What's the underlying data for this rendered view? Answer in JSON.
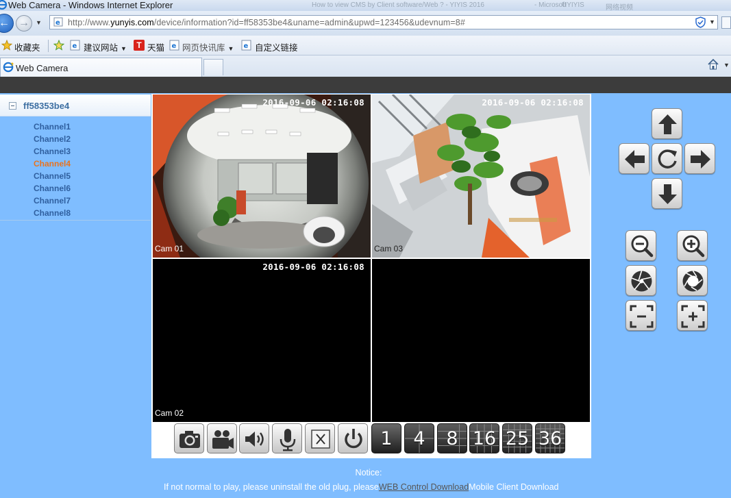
{
  "window": {
    "title": "Web Camera - Windows Internet Explorer",
    "background_title_fragment": "How to view CMS by Client software/Web ? - YIYIS 2016",
    "background_ctl": "- Microsoft",
    "background_ctl2": "UYIYIS",
    "background_tail": "网络视频"
  },
  "address_bar": {
    "url_prefix": "http://www.",
    "url_domain": "yunyis.com",
    "url_rest": "/device/information?id=ff58353be4&uname=admin&upwd=123456&udevnum=8#"
  },
  "favorites_bar": {
    "favorites_label": "收藏夹",
    "items": [
      {
        "label": "建议网站",
        "dropdown": true
      },
      {
        "label": "天猫",
        "dropdown": false
      },
      {
        "label": "网页快讯库",
        "dropdown": true
      },
      {
        "label": "自定义链接",
        "dropdown": false
      }
    ]
  },
  "tabs": [
    {
      "label": "Web Camera",
      "active": true
    }
  ],
  "sidebar": {
    "device_name": "ff58353be4",
    "channels": [
      {
        "label": "Channel1",
        "active": false
      },
      {
        "label": "Channel2",
        "active": false
      },
      {
        "label": "Channel3",
        "active": false
      },
      {
        "label": "Channel4",
        "active": true
      },
      {
        "label": "Channel5",
        "active": false
      },
      {
        "label": "Channel6",
        "active": false
      },
      {
        "label": "Channel7",
        "active": false
      },
      {
        "label": "Channel8",
        "active": false
      }
    ]
  },
  "video": {
    "cells": [
      {
        "timestamp": "2016-09-06 02:16:08",
        "cam_label": "Cam 01",
        "has_feed": true,
        "selected": false
      },
      {
        "timestamp": "2016-09-06 02:16:08",
        "cam_label": "Cam 03",
        "has_feed": true,
        "selected": true
      },
      {
        "timestamp": "2016-09-06 02:16:08",
        "cam_label": "Cam 02",
        "has_feed": false,
        "selected": false
      },
      {
        "timestamp": "",
        "cam_label": "",
        "has_feed": false,
        "selected": false
      }
    ]
  },
  "toolbar": {
    "action_buttons": [
      "snapshot-icon",
      "record-icon",
      "audio-icon",
      "microphone-icon",
      "close-all-icon",
      "power-icon"
    ],
    "layout_buttons": [
      "1",
      "4",
      "8",
      "16",
      "25",
      "36"
    ]
  },
  "ptz": {
    "direction_buttons": [
      "arrow-up-icon",
      "arrow-left-icon",
      "refresh-icon",
      "arrow-right-icon",
      "arrow-down-icon"
    ],
    "lens_buttons": [
      "zoom-out-icon",
      "zoom-in-icon",
      "iris-close-icon",
      "iris-open-icon",
      "focus-near-icon",
      "focus-far-icon"
    ]
  },
  "notice": {
    "title": "Notice:",
    "text": "If not normal to play, please uninstall the old plug, please",
    "web_control_link": "WEB Control Download",
    "mobile_client": "Mobile Client Download"
  },
  "colors": {
    "page_bg": "#7fbdff",
    "channel_text": "#2f5f9f",
    "channel_active": "#e8731f",
    "dark_strip": "#3c3c3c"
  }
}
